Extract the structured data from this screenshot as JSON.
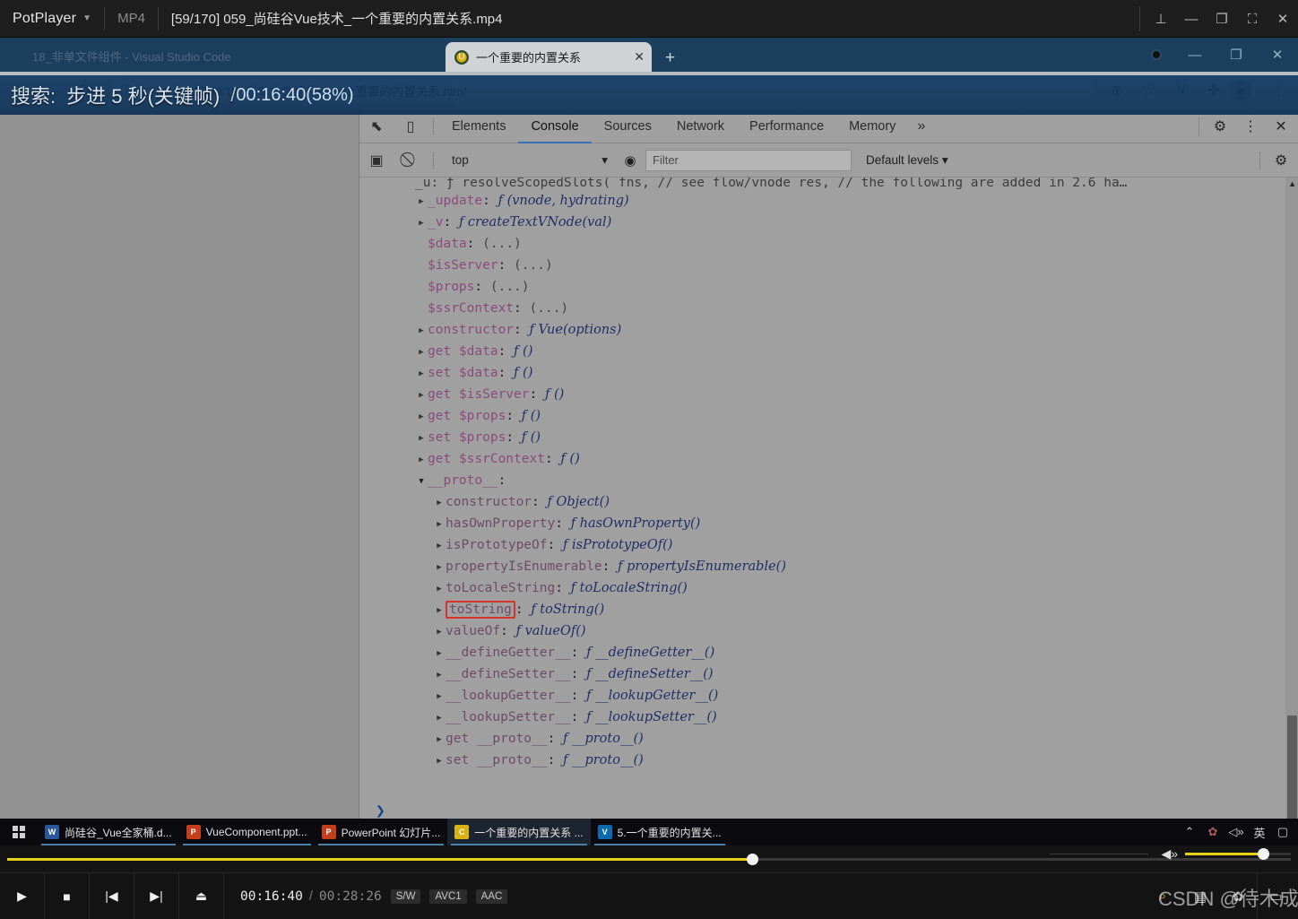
{
  "player": {
    "app_name": "PotPlayer",
    "format": "MP4",
    "title": "[59/170] 059_尚硅谷Vue技术_一个重要的内置关系.mp4",
    "window_buttons": [
      {
        "name": "pin",
        "glyph": "⊥"
      },
      {
        "name": "minimize",
        "glyph": "—"
      },
      {
        "name": "maximize",
        "glyph": "❐"
      },
      {
        "name": "fullscreen",
        "glyph": "⛶"
      },
      {
        "name": "close",
        "glyph": "✕"
      }
    ],
    "osd": {
      "label": "搜索:",
      "action": "步进 5 秒(关键帧)",
      "separator": "/",
      "time": "00:16:40(58%)"
    },
    "controls": {
      "play": "▶",
      "stop": "■",
      "previous": "◀◀",
      "next": "▶▶",
      "eject": "⏏",
      "current_time": "00:16:40",
      "separator": "/",
      "total_time": "00:28:26",
      "badges": [
        "S/W",
        "AVC1",
        "AAC"
      ],
      "progress_percent": 58,
      "volume_percent": 74,
      "right_buttons": [
        {
          "name": "playlist-search",
          "glyph": "⌕"
        },
        {
          "name": "playlist",
          "glyph": "▤"
        },
        {
          "name": "settings",
          "glyph": "✿"
        },
        {
          "name": "screen",
          "glyph": "▭"
        }
      ]
    },
    "watermark": "CSDN @待木成箱"
  },
  "browser": {
    "ghost_tab_title": "18_非单文件组件 - Visual Studio Code",
    "tab": {
      "title": "一个重要的内置关系",
      "favicon": "vue-favicon",
      "close": "✕"
    },
    "new_tab": "+",
    "window_buttons": [
      {
        "name": "minimize",
        "glyph": "—"
      },
      {
        "name": "restore",
        "glyph": "❐"
      },
      {
        "name": "close",
        "glyph": "✕"
      }
    ],
    "toolbar": {
      "back": "←",
      "forward": "→",
      "reload": "⟳",
      "url": "127.0.0.1:5500/18_非单文件组件/5.一个重要的内置关系.html",
      "info_icon": "ⓘ",
      "right_icons": [
        {
          "name": "zoom-icon",
          "glyph": "⊕"
        },
        {
          "name": "bookmark-star-icon",
          "glyph": "☆"
        },
        {
          "name": "vue-devtools-icon",
          "glyph": "V"
        },
        {
          "name": "extensions-puzzle-icon",
          "glyph": "🧩"
        },
        {
          "name": "profile-avatar-icon",
          "glyph": "●"
        },
        {
          "name": "chrome-menu-icon",
          "glyph": "⋮"
        }
      ]
    }
  },
  "devtools": {
    "tabs": [
      {
        "label": "Elements",
        "active": false
      },
      {
        "label": "Console",
        "active": true
      },
      {
        "label": "Sources",
        "active": false
      },
      {
        "label": "Network",
        "active": false
      },
      {
        "label": "Performance",
        "active": false
      },
      {
        "label": "Memory",
        "active": false
      }
    ],
    "more_tabs": "»",
    "left_icons": [
      {
        "name": "inspect-element-icon",
        "glyph": "⬉"
      },
      {
        "name": "device-toolbar-icon",
        "glyph": "▯"
      }
    ],
    "right_icons": [
      {
        "name": "settings-gear-icon",
        "glyph": "⚙"
      },
      {
        "name": "devtools-menu-icon",
        "glyph": "⋮"
      },
      {
        "name": "close-devtools-icon",
        "glyph": "✕"
      }
    ],
    "filterbar": {
      "sidebar_toggle": "▣",
      "clear_console": "⃠",
      "context": "top",
      "context_caret": "▾",
      "eye_icon": "◉",
      "filter_placeholder": "Filter",
      "levels": "Default levels",
      "levels_caret": "▾",
      "settings": "⚙"
    },
    "console": {
      "clipped_top_line": "_u: ƒ resolveScopedSlots( fns, // see flow/vnode res, // the following are added in 2.6 ha…",
      "prompt": "❯",
      "lines": [
        {
          "indent": 0,
          "arrow": "closed",
          "name": "_update",
          "sep": ":",
          "value": "(vnode, hydrating)",
          "fn": true
        },
        {
          "indent": 0,
          "arrow": "closed",
          "name": "_v",
          "sep": ":",
          "value": "createTextVNode(val)",
          "fn": true
        },
        {
          "indent": 0,
          "arrow": "none",
          "name": "$data",
          "sep": ":",
          "value": "(...)",
          "fn": false
        },
        {
          "indent": 0,
          "arrow": "none",
          "name": "$isServer",
          "sep": ":",
          "value": "(...)",
          "fn": false
        },
        {
          "indent": 0,
          "arrow": "none",
          "name": "$props",
          "sep": ":",
          "value": "(...)",
          "fn": false
        },
        {
          "indent": 0,
          "arrow": "none",
          "name": "$ssrContext",
          "sep": ":",
          "value": "(...)",
          "fn": false
        },
        {
          "indent": 0,
          "arrow": "closed",
          "name": "constructor",
          "sep": ":",
          "value": "Vue(options)",
          "fn": true
        },
        {
          "indent": 0,
          "arrow": "closed",
          "name": "get $data",
          "sep": ":",
          "value": "()",
          "fn": true
        },
        {
          "indent": 0,
          "arrow": "closed",
          "name": "set $data",
          "sep": ":",
          "value": "()",
          "fn": true
        },
        {
          "indent": 0,
          "arrow": "closed",
          "name": "get $isServer",
          "sep": ":",
          "value": "()",
          "fn": true
        },
        {
          "indent": 0,
          "arrow": "closed",
          "name": "get $props",
          "sep": ":",
          "value": "()",
          "fn": true
        },
        {
          "indent": 0,
          "arrow": "closed",
          "name": "set $props",
          "sep": ":",
          "value": "()",
          "fn": true
        },
        {
          "indent": 0,
          "arrow": "closed",
          "name": "get $ssrContext",
          "sep": ":",
          "value": "()",
          "fn": true
        },
        {
          "indent": 0,
          "arrow": "open",
          "name": "__proto__",
          "sep": ":",
          "value": "",
          "fn": false
        },
        {
          "indent": 1,
          "arrow": "closed",
          "name": "constructor",
          "sep": ":",
          "value": "Object()",
          "fn": true
        },
        {
          "indent": 1,
          "arrow": "closed",
          "name": "hasOwnProperty",
          "sep": ":",
          "value": "hasOwnProperty()",
          "fn": true
        },
        {
          "indent": 1,
          "arrow": "closed",
          "name": "isPrototypeOf",
          "sep": ":",
          "value": "isPrototypeOf()",
          "fn": true
        },
        {
          "indent": 1,
          "arrow": "closed",
          "name": "propertyIsEnumerable",
          "sep": ":",
          "value": "propertyIsEnumerable()",
          "fn": true
        },
        {
          "indent": 1,
          "arrow": "closed",
          "name": "toLocaleString",
          "sep": ":",
          "value": "toLocaleString()",
          "fn": true
        },
        {
          "indent": 1,
          "arrow": "closed",
          "name": "toString",
          "sep": ":",
          "value": "toString()",
          "fn": true,
          "highlight": true
        },
        {
          "indent": 1,
          "arrow": "closed",
          "name": "valueOf",
          "sep": ":",
          "value": "valueOf()",
          "fn": true
        },
        {
          "indent": 1,
          "arrow": "closed",
          "name": "__defineGetter__",
          "sep": ":",
          "value": "__defineGetter__()",
          "fn": true
        },
        {
          "indent": 1,
          "arrow": "closed",
          "name": "__defineSetter__",
          "sep": ":",
          "value": "__defineSetter__()",
          "fn": true
        },
        {
          "indent": 1,
          "arrow": "closed",
          "name": "__lookupGetter__",
          "sep": ":",
          "value": "__lookupGetter__()",
          "fn": true
        },
        {
          "indent": 1,
          "arrow": "closed",
          "name": "__lookupSetter__",
          "sep": ":",
          "value": "__lookupSetter__()",
          "fn": true
        },
        {
          "indent": 1,
          "arrow": "closed",
          "name": "get __proto__",
          "sep": ":",
          "value": "__proto__()",
          "fn": true
        },
        {
          "indent": 1,
          "arrow": "closed",
          "name": "set __proto__",
          "sep": ":",
          "value": "__proto__()",
          "fn": true
        }
      ]
    }
  },
  "taskbar": {
    "start_button": "start-windows-logo",
    "items": [
      {
        "label": "尚硅谷_Vue全家桶.d...",
        "icon": "W",
        "color": "#2b579a",
        "active": false
      },
      {
        "label": "VueComponent.ppt...",
        "icon": "P",
        "color": "#c43e1c",
        "active": false
      },
      {
        "label": "PowerPoint 幻灯片...",
        "icon": "P",
        "color": "#c43e1c",
        "active": false
      },
      {
        "label": "一个重要的内置关系 ...",
        "icon": "C",
        "color": "#d8b114",
        "active": true
      },
      {
        "label": "5.一个重要的内置关...",
        "icon": "V",
        "color": "#0d6ab0",
        "active": false
      }
    ],
    "tray": [
      {
        "name": "show-hidden-icons",
        "glyph": "⌃"
      },
      {
        "name": "antivirus-icon",
        "glyph": "✿"
      },
      {
        "name": "volume-icon",
        "glyph": "🕪"
      },
      {
        "name": "ime-language-icon",
        "glyph": "英"
      },
      {
        "name": "action-center-icon",
        "glyph": "▢"
      }
    ]
  }
}
